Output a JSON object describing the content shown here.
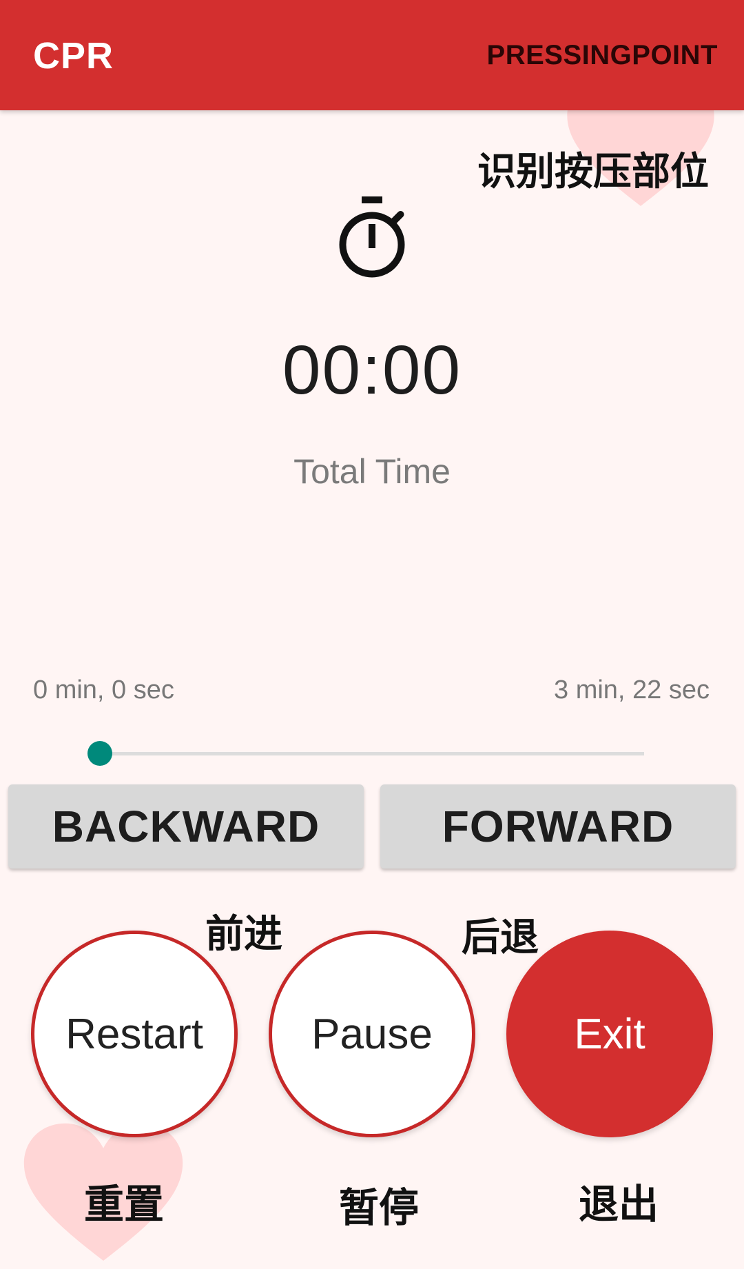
{
  "app_bar": {
    "title": "CPR",
    "action_label": "PRESSINGPOINT"
  },
  "annotations": {
    "pressing_point": "识别按压部位",
    "forward": "前进",
    "backward": "后退",
    "restart": "重置",
    "pause": "暂停",
    "exit": "退出"
  },
  "timer": {
    "icon": "stopwatch-icon",
    "value": "00:00",
    "label": "Total Time"
  },
  "progress": {
    "start_label": "0 min, 0 sec",
    "end_label": "3 min, 22 sec",
    "fraction": 0
  },
  "buttons": {
    "backward": "BACKWARD",
    "forward": "FORWARD",
    "restart": "Restart",
    "pause": "Pause",
    "exit": "Exit"
  },
  "colors": {
    "primary": "#d32f2f",
    "accent": "#00897b",
    "background": "#fff5f4",
    "heart": "#ffd6d6"
  }
}
